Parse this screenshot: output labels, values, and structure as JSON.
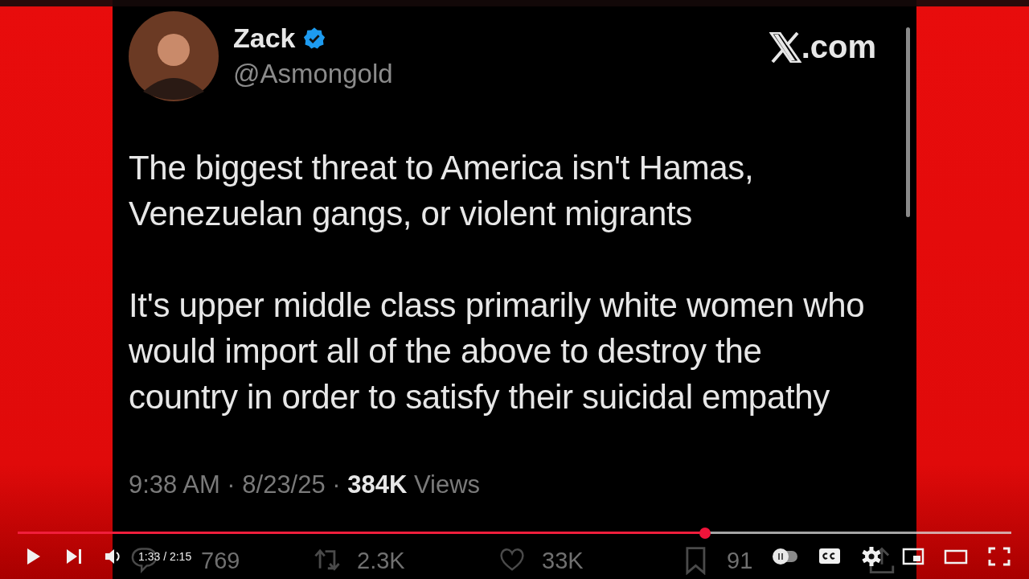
{
  "tweet": {
    "author": {
      "name": "Zack",
      "verified": true,
      "handle": "@Asmongold"
    },
    "site": ".com",
    "paragraphs": [
      "The biggest threat to America isn't Hamas, Venezuelan gangs, or violent migrants",
      "It's upper middle class primarily white women who would import all of the above to destroy the country in order to satisfy their suicidal empathy"
    ],
    "meta": "9:38 AM · 8/23/25 · **384K** Views",
    "stats": [
      {
        "kind": "reply",
        "count": "769"
      },
      {
        "kind": "repost",
        "count": "2.3K"
      },
      {
        "kind": "like",
        "count": "33K"
      },
      {
        "kind": "bookmark",
        "count": "91"
      },
      {
        "kind": "share"
      }
    ]
  },
  "player": {
    "progress": {
      "level": 0.692
    },
    "left_controls": [
      {
        "kind": "play"
      },
      {
        "kind": "next"
      },
      {
        "kind": "volume"
      }
    ],
    "time": "1:33 / 2:15",
    "right_controls": [
      {
        "kind": "autoplay"
      },
      {
        "kind": "captions"
      },
      {
        "kind": "settings"
      },
      {
        "kind": "miniplayer"
      },
      {
        "kind": "theater"
      },
      {
        "kind": "fullscreen"
      }
    ]
  }
}
